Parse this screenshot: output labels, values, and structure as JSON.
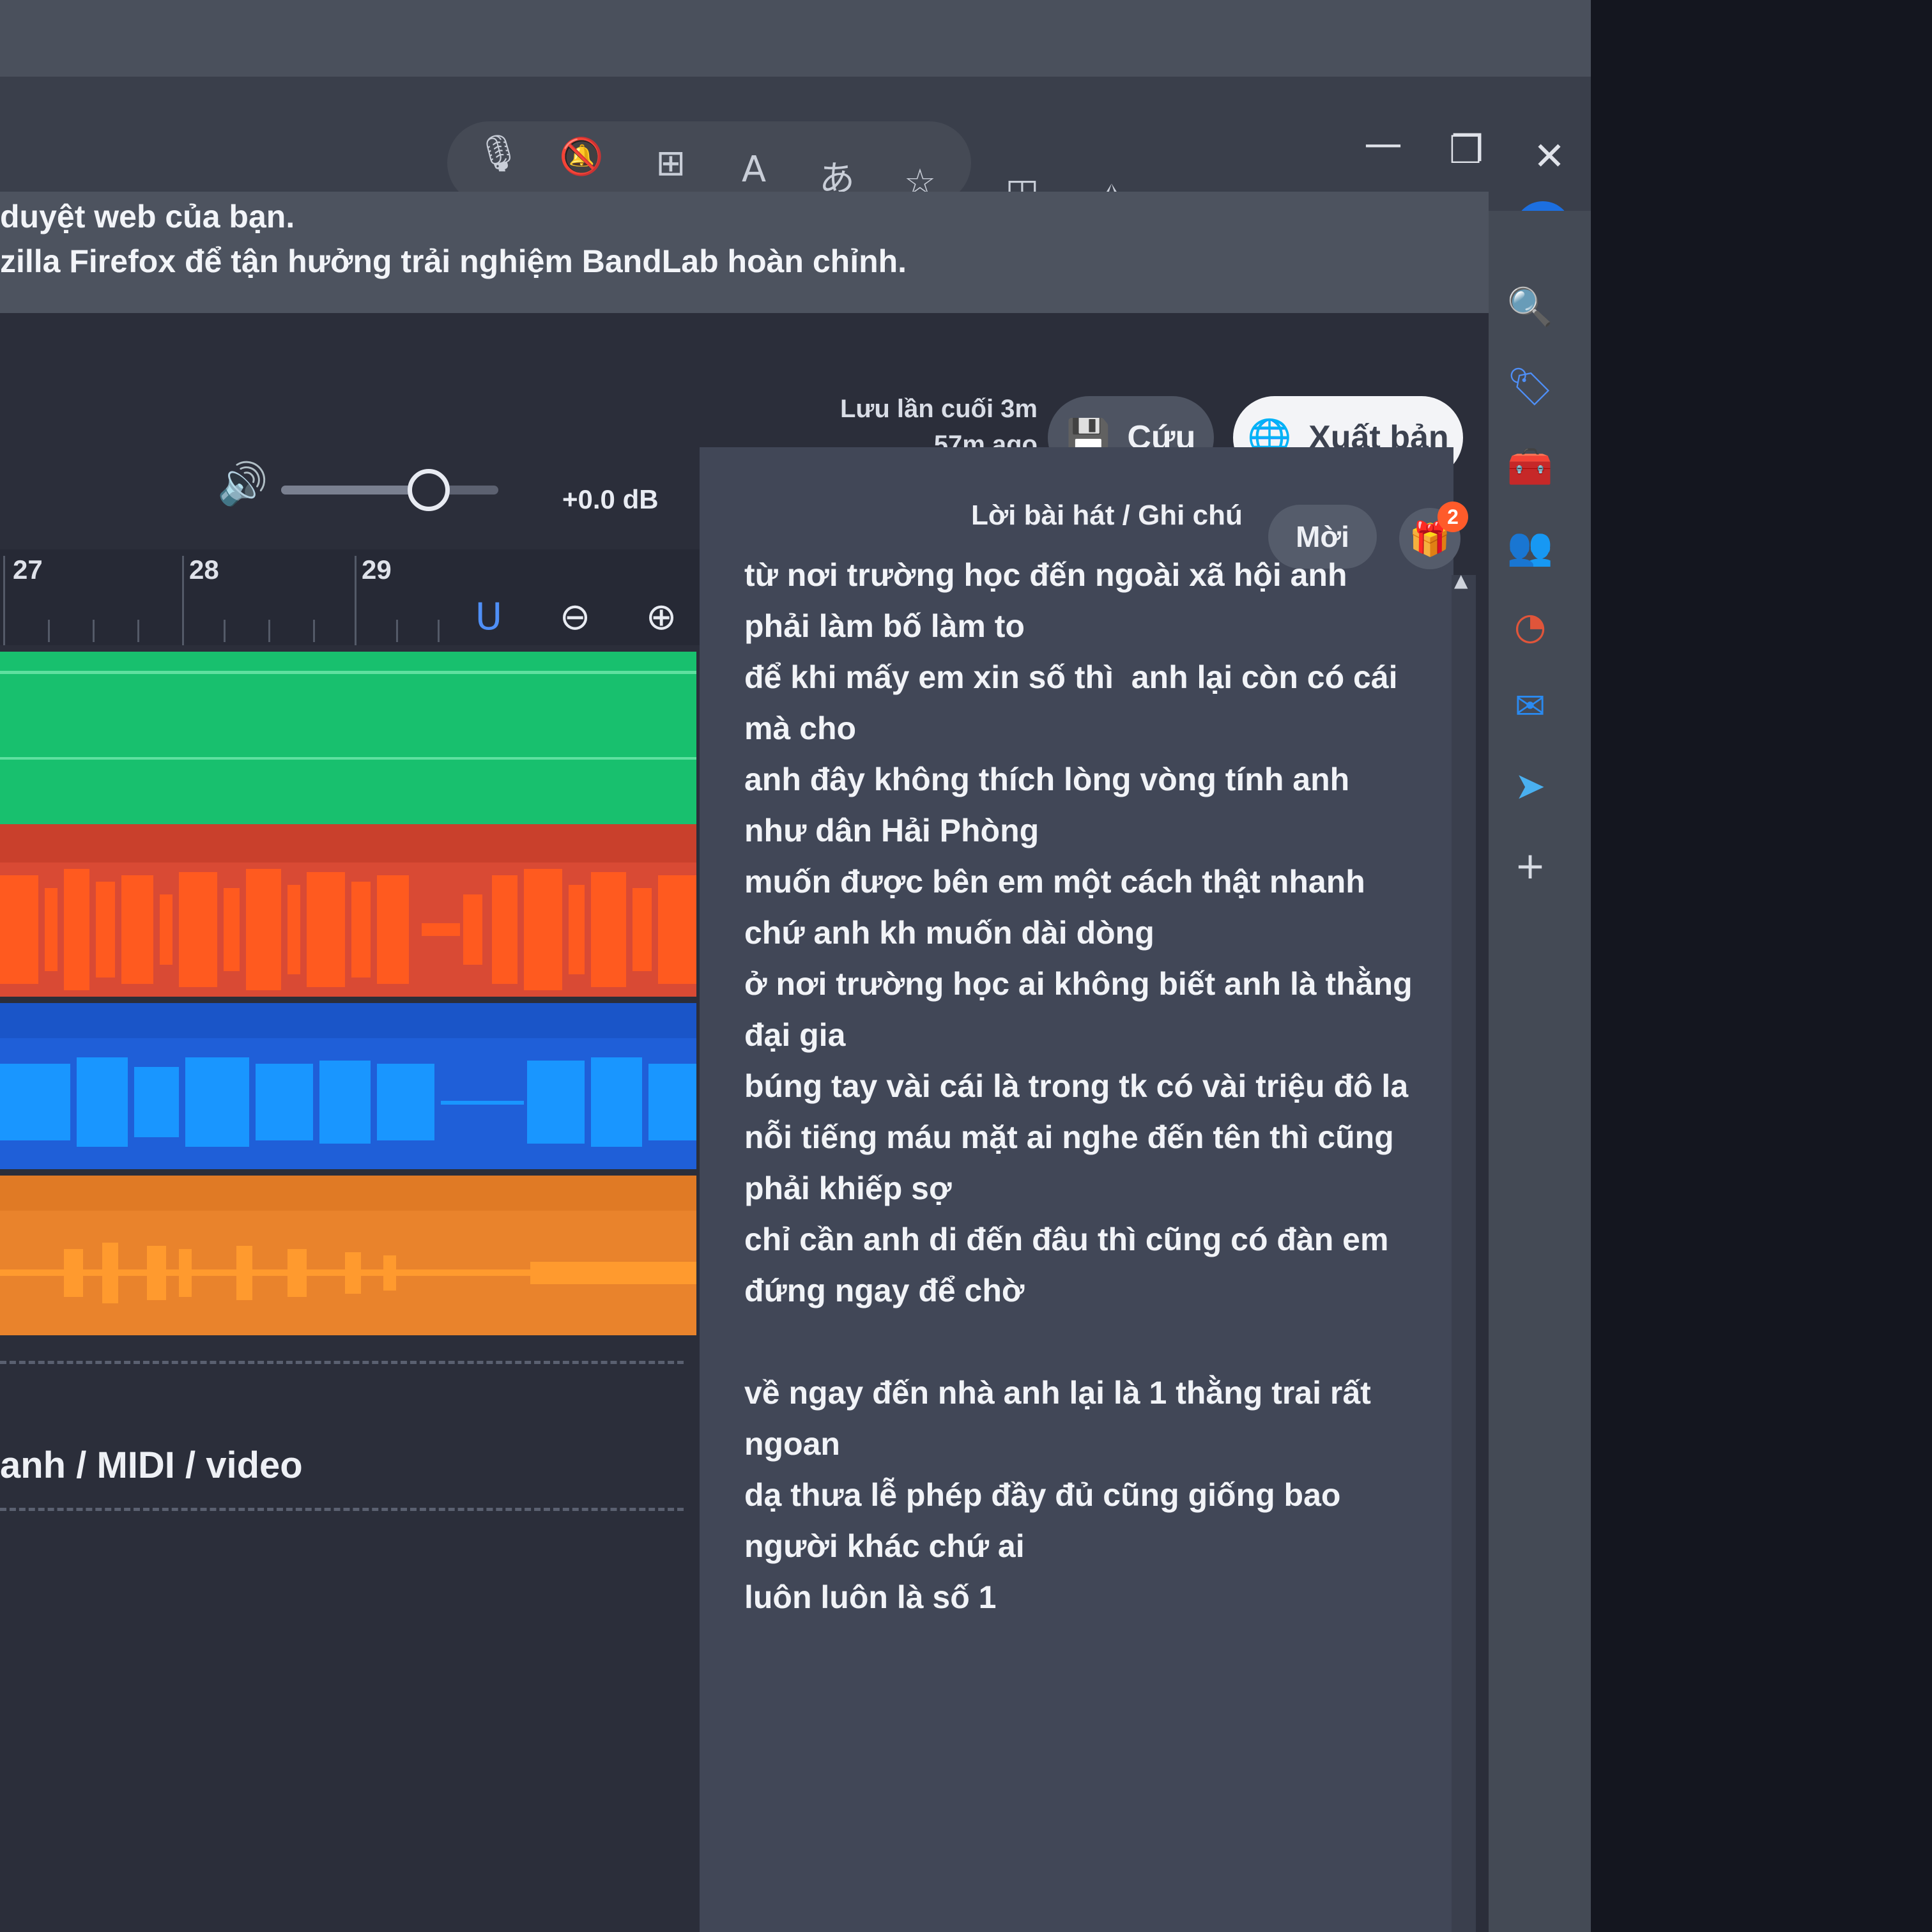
{
  "browser": {
    "window_controls": {
      "minimize": "—",
      "restore": "❐",
      "close": "✕"
    },
    "toolbar_icons": [
      "microphone-icon",
      "bell-off-icon",
      "app-grid-icon",
      "read-aloud-icon",
      "translate-icon",
      "favorite-star-icon",
      "split-screen-icon",
      "favorites-list-icon",
      "collections-icon",
      "health-icon",
      "profile-icon",
      "more-icon",
      "bing-icon"
    ],
    "sidebar_icons": [
      "search-icon",
      "tag-icon",
      "tools-icon",
      "people-icon",
      "office-icon",
      "outlook-icon",
      "send-icon",
      "add-icon"
    ]
  },
  "banner": {
    "line1": "duyệt web của bạn.",
    "line2": "zilla Firefox để tận hưởng trải nghiệm BandLab hoàn chỉnh."
  },
  "header": {
    "saved_line1": "Lưu lần cuối 3m",
    "saved_line2": "57m ago",
    "save_label": "Cứu",
    "publish_label": "Xuất bản"
  },
  "transport": {
    "volume_db": "+0.0 dB",
    "volume_level": 0.68
  },
  "timeline": {
    "ruler": [
      "27",
      "28",
      "29"
    ]
  },
  "tracks": [
    {
      "name": "green-track",
      "color": "#18c06e"
    },
    {
      "name": "red-track",
      "color": "#ff4b1f"
    },
    {
      "name": "blue-track",
      "color": "#1a6cf0"
    },
    {
      "name": "orange-track",
      "color": "#f38a2a"
    }
  ],
  "drop_zone": {
    "label": "anh / MIDI / video"
  },
  "lyrics": {
    "title": "Lời bài hát / Ghi chú",
    "invite_label": "Mời",
    "gift_badge": "2",
    "lines": [
      "từ nơi trường học đến ngoài xã hội anh",
      "phải làm bố làm to",
      "để khi mấy em xin số thì  anh lại còn có cái",
      "mà cho",
      "anh đây không thích lòng vòng tính anh",
      "như dân Hải Phòng",
      "muốn được bên em một cách thật nhanh",
      "chứ anh kh muốn dài dòng",
      "ở nơi trường học ai không biết anh là thằng",
      "đại gia",
      "búng tay vài cái là trong tk có vài triệu đô la",
      "nỗi tiếng máu mặt ai nghe đến tên thì cũng",
      "phải khiếp sợ",
      "chỉ cần anh di đến đâu thì cũng có đàn em",
      "đứng ngay để chờ",
      " ",
      "về ngay đến nhà anh lại là 1 thằng trai rất",
      "ngoan",
      "dạ thưa lễ phép đầy đủ cũng giống bao",
      "người khác chứ ai",
      "luôn luôn là số 1"
    ]
  }
}
